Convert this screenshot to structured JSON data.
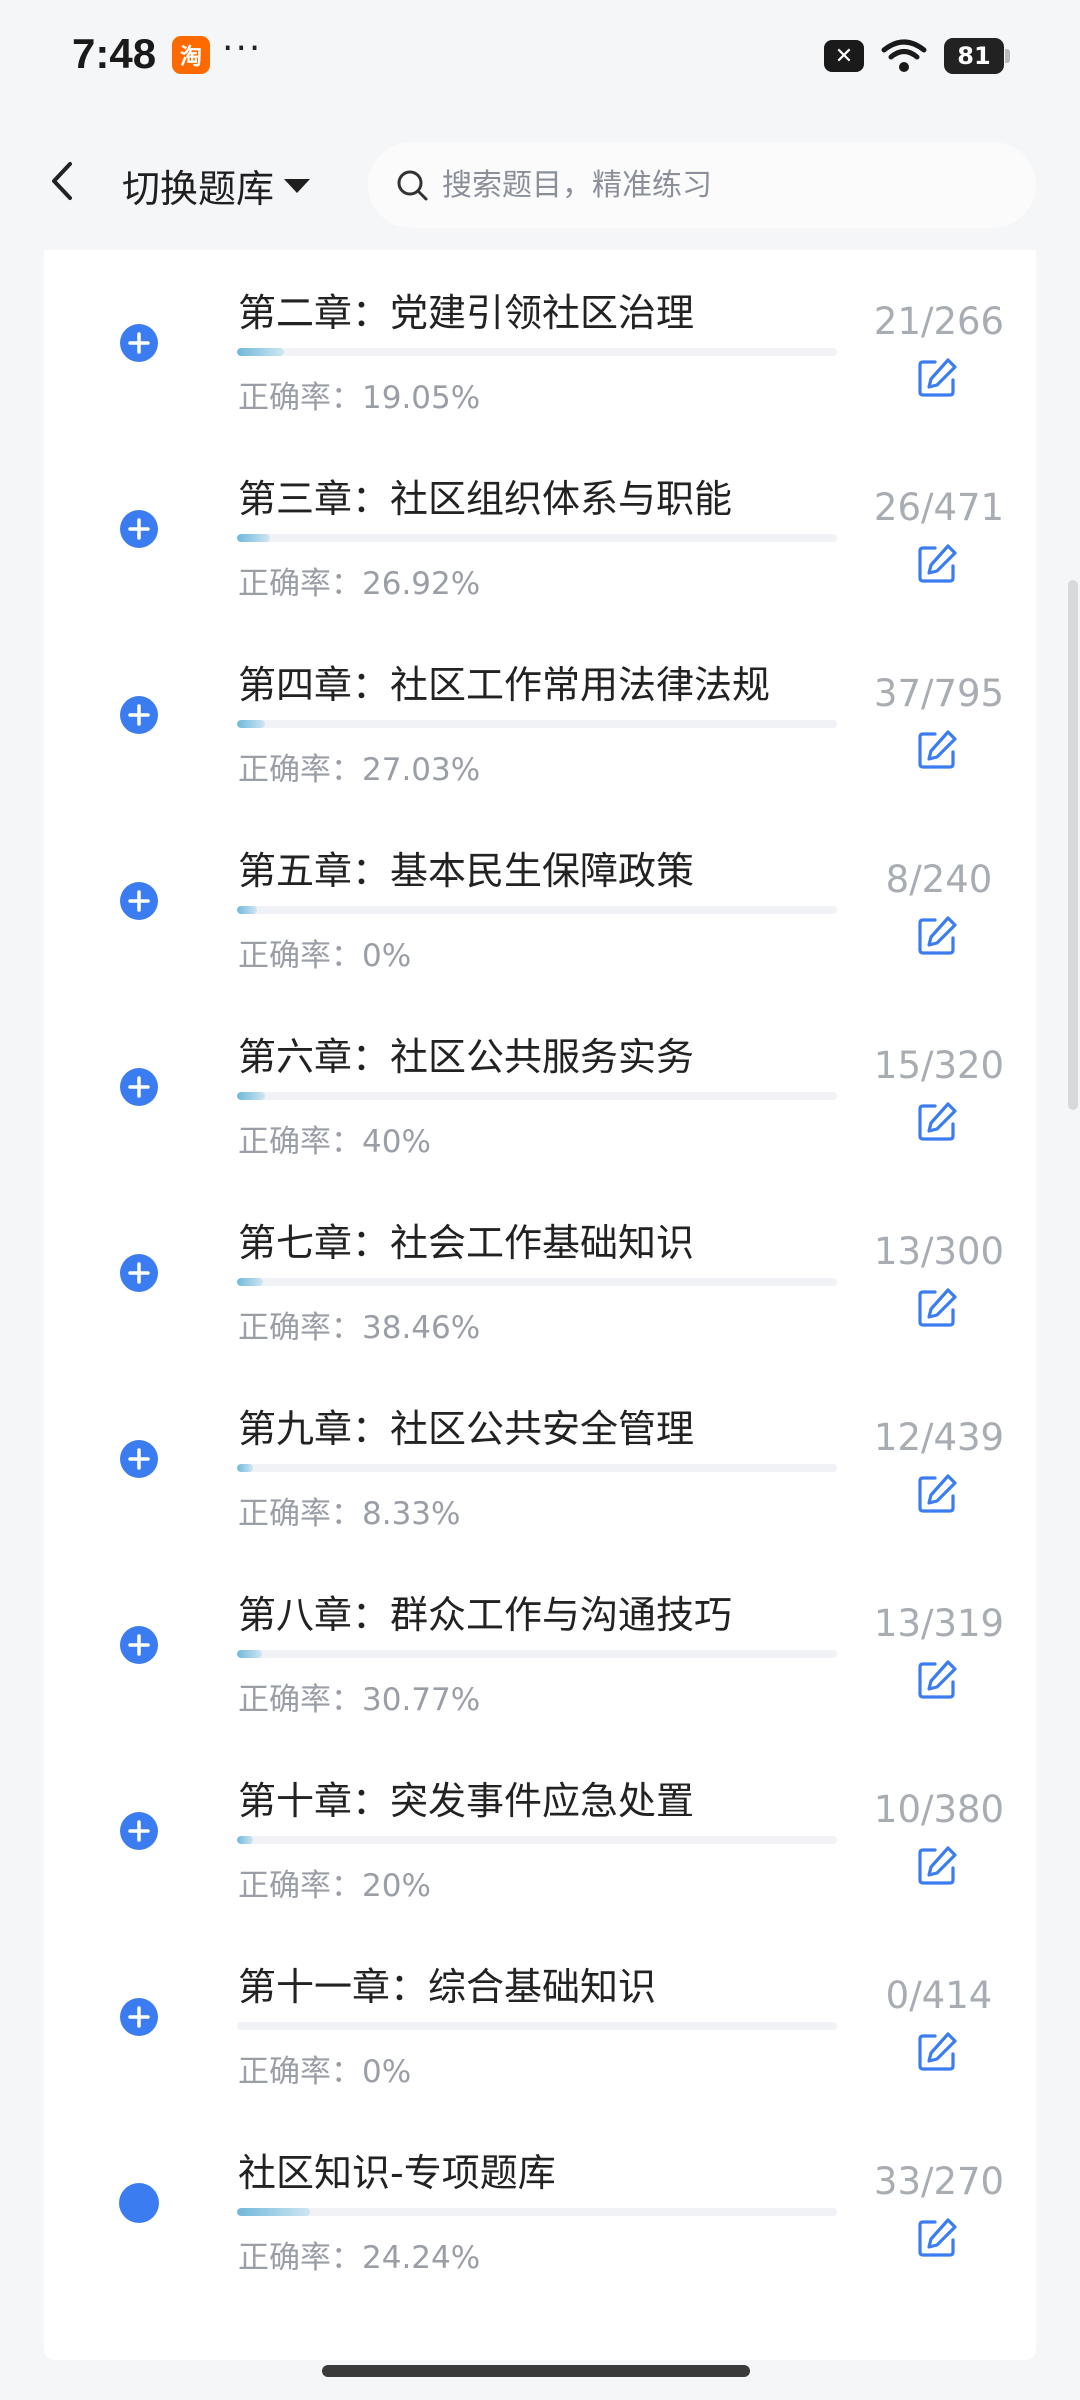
{
  "status": {
    "time": "7:48",
    "app_badge": "淘",
    "more_dots": "···",
    "battery": "81"
  },
  "nav": {
    "switch_label": "切换题库",
    "search_placeholder": "搜索题目，精准练习"
  },
  "colors": {
    "accent": "#3b7cf0",
    "progress": "#6fb8dc",
    "muted": "#a8acb3"
  },
  "items": [
    {
      "title": "第二章：党建引领社区治理",
      "accuracy": "正确率：19.05%",
      "count": "21/266",
      "progress": 0.079,
      "icon": "plus-icon"
    },
    {
      "title": "第三章：社区组织体系与职能",
      "accuracy": "正确率：26.92%",
      "count": "26/471",
      "progress": 0.055,
      "icon": "plus-icon"
    },
    {
      "title": "第四章：社区工作常用法律法规",
      "accuracy": "正确率：27.03%",
      "count": "37/795",
      "progress": 0.047,
      "icon": "plus-icon"
    },
    {
      "title": "第五章：基本民生保障政策",
      "accuracy": "正确率：0%",
      "count": "8/240",
      "progress": 0.033,
      "icon": "plus-icon"
    },
    {
      "title": "第六章：社区公共服务实务",
      "accuracy": "正确率：40%",
      "count": "15/320",
      "progress": 0.047,
      "icon": "plus-icon"
    },
    {
      "title": "第七章：社会工作基础知识",
      "accuracy": "正确率：38.46%",
      "count": "13/300",
      "progress": 0.043,
      "icon": "plus-icon"
    },
    {
      "title": "第九章：社区公共安全管理",
      "accuracy": "正确率：8.33%",
      "count": "12/439",
      "progress": 0.027,
      "icon": "plus-icon"
    },
    {
      "title": "第八章：群众工作与沟通技巧",
      "accuracy": "正确率：30.77%",
      "count": "13/319",
      "progress": 0.041,
      "icon": "plus-icon"
    },
    {
      "title": "第十章：突发事件应急处置",
      "accuracy": "正确率：20%",
      "count": "10/380",
      "progress": 0.026,
      "icon": "plus-icon"
    },
    {
      "title": "第十一章：综合基础知识",
      "accuracy": "正确率：0%",
      "count": "0/414",
      "progress": 0,
      "icon": "plus-icon"
    },
    {
      "title": "社区知识-专项题库",
      "accuracy": "正确率：24.24%",
      "count": "33/270",
      "progress": 0.122,
      "icon": "dot-icon"
    }
  ]
}
